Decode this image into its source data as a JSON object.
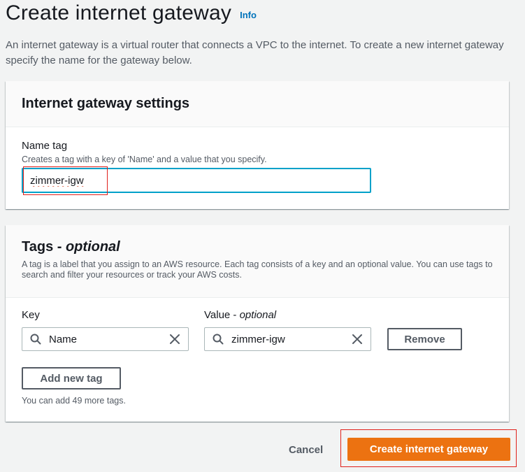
{
  "header": {
    "title": "Create internet gateway",
    "info_label": "Info",
    "description": "An internet gateway is a virtual router that connects a VPC to the internet. To create a new internet gateway specify the name for the gateway below."
  },
  "settings_panel": {
    "title": "Internet gateway settings",
    "name_tag": {
      "label": "Name tag",
      "description": "Creates a tag with a key of 'Name' and a value that you specify.",
      "value": "zimmer-igw"
    }
  },
  "tags_panel": {
    "title": "Tags - ",
    "title_optional": "optional",
    "description": "A tag is a label that you assign to an AWS resource. Each tag consists of a key and an optional value. You can use tags to search and filter your resources or track your AWS costs.",
    "key_label": "Key",
    "value_label": "Value - ",
    "value_label_optional": "optional",
    "rows": [
      {
        "key": "Name",
        "value": "zimmer-igw",
        "remove_label": "Remove"
      }
    ],
    "add_tag_label": "Add new tag",
    "hint": "You can add 49 more tags."
  },
  "footer": {
    "cancel_label": "Cancel",
    "submit_label": "Create internet gateway"
  },
  "colors": {
    "accent": "#ec7211",
    "link": "#0073bb",
    "focus": "#00a1c9",
    "annotation_red": "#e0201b"
  },
  "icons": {
    "search": "search-icon",
    "clear": "close-icon"
  }
}
